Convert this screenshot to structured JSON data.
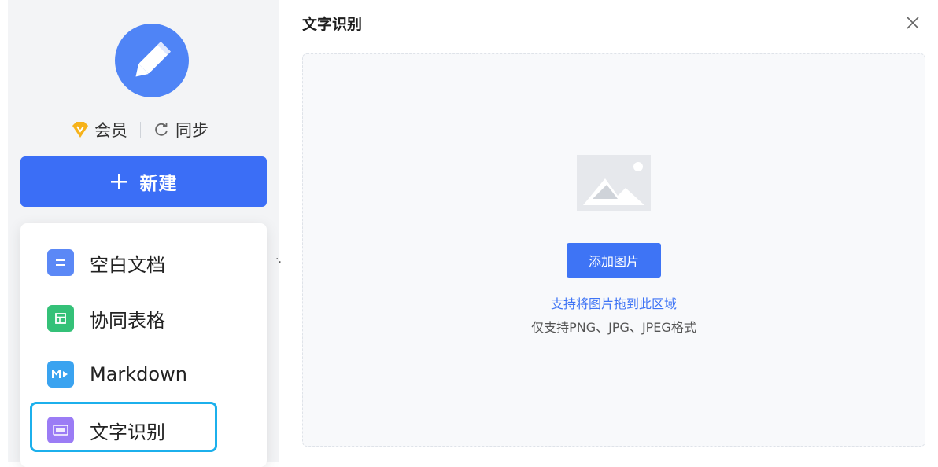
{
  "sidebar": {
    "member_label": "会员",
    "sync_label": "同步",
    "new_button_label": "新建",
    "menu_items": [
      {
        "label": "空白文档",
        "icon": "blank-doc-icon",
        "color": "#5b88f6"
      },
      {
        "label": "协同表格",
        "icon": "sheet-icon",
        "color": "#34c178"
      },
      {
        "label": "Markdown",
        "icon": "markdown-icon",
        "color": "#3aa3f0"
      },
      {
        "label": "文字识别",
        "icon": "ocr-icon",
        "color": "#9b7cf5",
        "selected": true
      }
    ]
  },
  "panel": {
    "title": "文字识别",
    "add_image_label": "添加图片",
    "drag_hint": "支持将图片拖到此区域",
    "format_hint": "仅支持PNG、JPG、JPEG格式"
  },
  "colors": {
    "accent": "#3b6ef6",
    "highlight_border": "#1cb0ec"
  }
}
